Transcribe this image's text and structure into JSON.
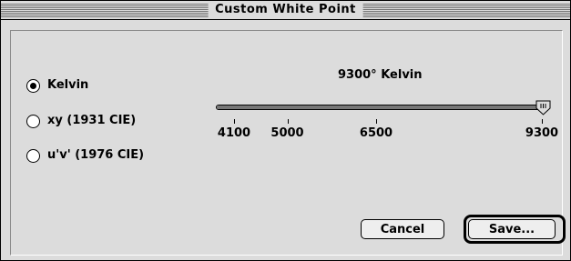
{
  "window": {
    "title": "Custom White Point"
  },
  "options": [
    {
      "label": "Kelvin",
      "checked": true
    },
    {
      "label": "xy (1931 CIE)",
      "checked": false
    },
    {
      "label": "u'v' (1976 CIE)",
      "checked": false
    }
  ],
  "kelvin": {
    "readout": "9300° Kelvin",
    "slider": {
      "min": 4100,
      "max": 9300,
      "value": 9300
    },
    "ticks": [
      {
        "label": "4100",
        "value": 4100
      },
      {
        "label": "5000",
        "value": 5000
      },
      {
        "label": "6500",
        "value": 6500
      },
      {
        "label": "9300",
        "value": 9300
      }
    ]
  },
  "buttons": {
    "cancel": "Cancel",
    "save": "Save..."
  }
}
